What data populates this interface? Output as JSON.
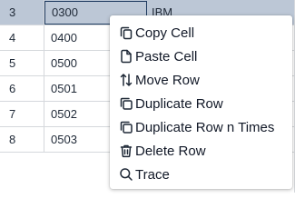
{
  "table": {
    "rows": [
      {
        "num": "3",
        "code": "0300",
        "name": "IBM",
        "selected": true
      },
      {
        "num": "4",
        "code": "0400",
        "name": ""
      },
      {
        "num": "5",
        "code": "0500",
        "name": ""
      },
      {
        "num": "6",
        "code": "0501",
        "name": ""
      },
      {
        "num": "7",
        "code": "0502",
        "name": ""
      },
      {
        "num": "8",
        "code": "0503",
        "name": ""
      }
    ]
  },
  "context_menu": {
    "items": [
      {
        "label": "Copy Cell",
        "icon": "copy-icon"
      },
      {
        "label": "Paste Cell",
        "icon": "file-icon"
      },
      {
        "label": "Move Row",
        "icon": "move-arrows-icon"
      },
      {
        "label": "Duplicate Row",
        "icon": "duplicate-icon"
      },
      {
        "label": "Duplicate Row n Times",
        "icon": "duplicate-icon"
      },
      {
        "label": "Delete Row",
        "icon": "trash-icon"
      },
      {
        "label": "Trace",
        "icon": "search-icon"
      }
    ]
  }
}
